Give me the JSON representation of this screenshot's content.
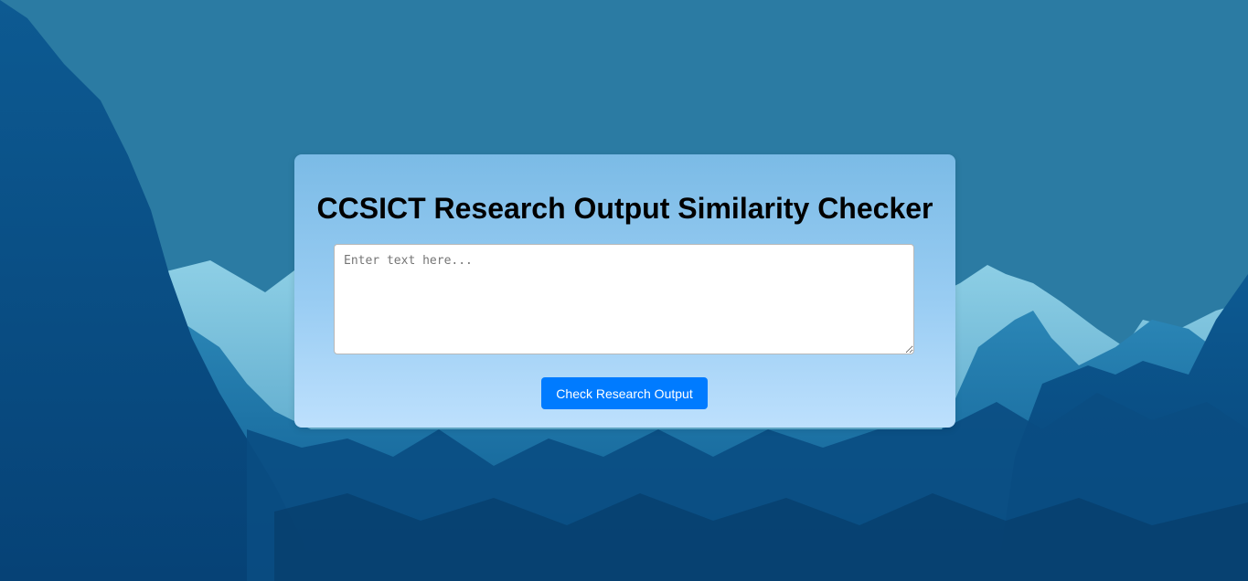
{
  "page": {
    "title": "CCSICT Research Output Similarity Checker"
  },
  "form": {
    "text_input": {
      "value": "",
      "placeholder": "Enter text here..."
    },
    "submit_label": "Check Research Output"
  },
  "colors": {
    "page_background": "#2b7ba3",
    "mountain_dark": "#0b4f86",
    "mountain_light": "#6ab7d6",
    "card_gradient_top": "#7bbbe6",
    "card_gradient_bottom": "#bde0fd",
    "button": "#007bff",
    "button_text": "#ffffff",
    "title_text": "#000000"
  },
  "background": {
    "image": "blue-mountain-landscape"
  }
}
